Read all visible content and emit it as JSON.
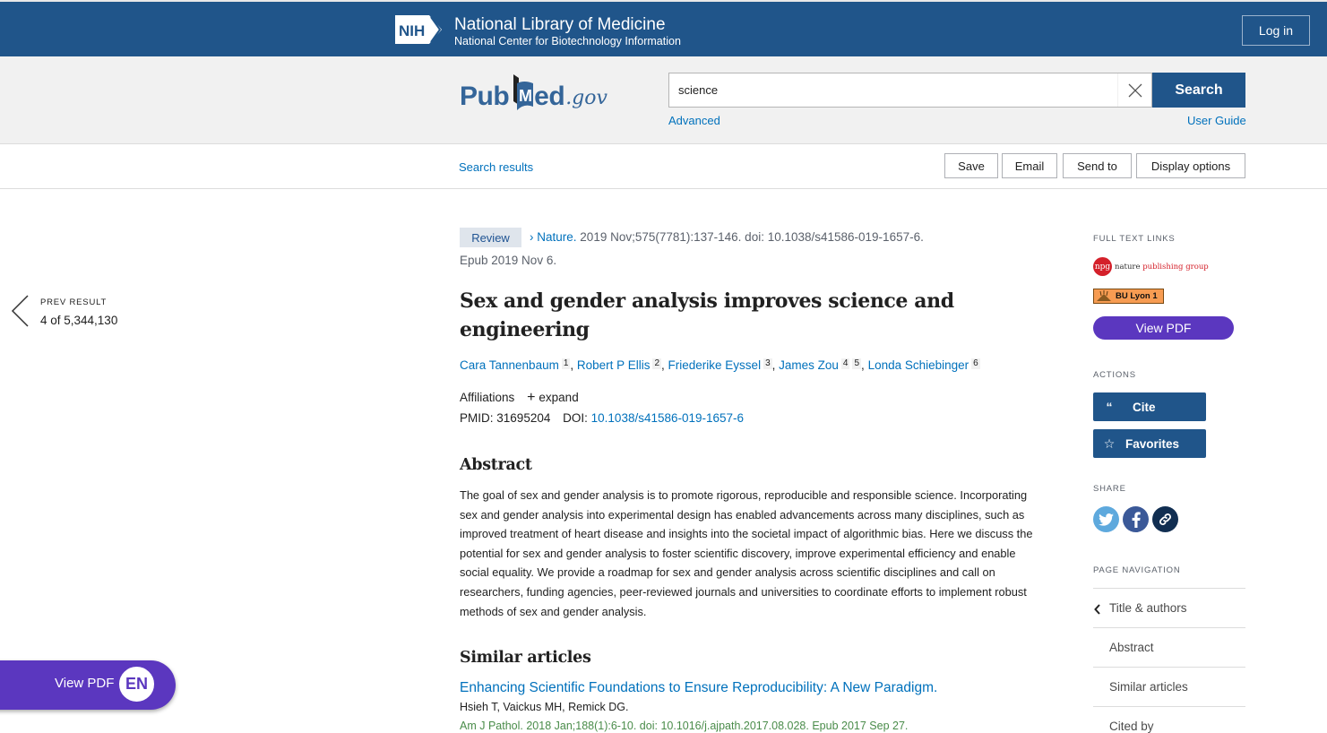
{
  "nih_banner": {
    "logo_text": "NIH",
    "title": "National Library of Medicine",
    "subtitle": "National Center for Biotechnology Information",
    "login_label": "Log in"
  },
  "search": {
    "logo_main": "PubMed",
    "logo_suffix": ".gov",
    "query": "science",
    "clear_icon": "close-icon",
    "button_label": "Search",
    "advanced_label": "Advanced",
    "user_guide_label": "User Guide"
  },
  "action_bar": {
    "back_link": "Search results",
    "buttons": [
      "Save",
      "Email",
      "Send to",
      "Display options"
    ]
  },
  "pager": {
    "label": "PREV RESULT",
    "position": "4 of 5,344,130"
  },
  "article": {
    "type_badge": "Review",
    "journal": "Nature.",
    "citation": " 2019 Nov;575(7781):137-146. doi: 10.1038/s41586-019-1657-6.",
    "epub": "Epub 2019 Nov 6.",
    "title": "Sex and gender analysis improves science and engineering",
    "authors": [
      {
        "name": "Cara Tannenbaum",
        "affil": "1"
      },
      {
        "name": "Robert P Ellis",
        "affil": "2"
      },
      {
        "name": "Friederike Eyssel",
        "affil": "3"
      },
      {
        "name": "James Zou",
        "affil": "4",
        "affil2": "5"
      },
      {
        "name": "Londa Schiebinger",
        "affil": "6"
      }
    ],
    "affiliations_label": "Affiliations",
    "expand_label": "expand",
    "pmid_label": "PMID:",
    "pmid": "31695204",
    "doi_label": "DOI:",
    "doi": "10.1038/s41586-019-1657-6",
    "abstract_heading": "Abstract",
    "abstract": "The goal of sex and gender analysis is to promote rigorous, reproducible and responsible science. Incorporating sex and gender analysis into experimental design has enabled advancements across many disciplines, such as improved treatment of heart disease and insights into the societal impact of algorithmic bias. Here we discuss the potential for sex and gender analysis to foster scientific discovery, improve experimental efficiency and enable social equality. We provide a roadmap for sex and gender analysis across scientific disciplines and call on researchers, funding agencies, peer-reviewed journals and universities to coordinate efforts to implement robust methods of sex and gender analysis.",
    "similar_heading": "Similar articles",
    "similar": [
      {
        "title": "Enhancing Scientific Foundations to Ensure Reproducibility: A New Paradigm.",
        "authors": "Hsieh T, Vaickus MH, Remick DG.",
        "citation": "Am J Pathol. 2018 Jan;188(1):6-10. doi: 10.1016/j.ajpath.2017.08.028. Epub 2017 Sep 27."
      }
    ]
  },
  "sidebar": {
    "full_text_label": "FULL TEXT LINKS",
    "npg_logo_abbr": "npg",
    "npg_name_parts": [
      "nature ",
      "publishing",
      " ",
      "group"
    ],
    "bu_label": "BU Lyon 1",
    "view_pdf_label": "View PDF",
    "actions_label": "ACTIONS",
    "cite_label": "Cite",
    "favorites_label": "Favorites",
    "share_label": "SHARE",
    "share_icons": [
      "twitter-icon",
      "facebook-icon",
      "link-icon"
    ],
    "page_nav_label": "PAGE NAVIGATION",
    "page_nav": [
      "Title & authors",
      "Abstract",
      "Similar articles",
      "Cited by"
    ]
  },
  "floating_pdf": {
    "label": "View PDF",
    "lang": "EN"
  },
  "colors": {
    "nih_blue": "#20558a",
    "link_blue": "#0071bc",
    "pdf_purple": "#5b37bf",
    "citation_green": "#4a8c4a"
  }
}
